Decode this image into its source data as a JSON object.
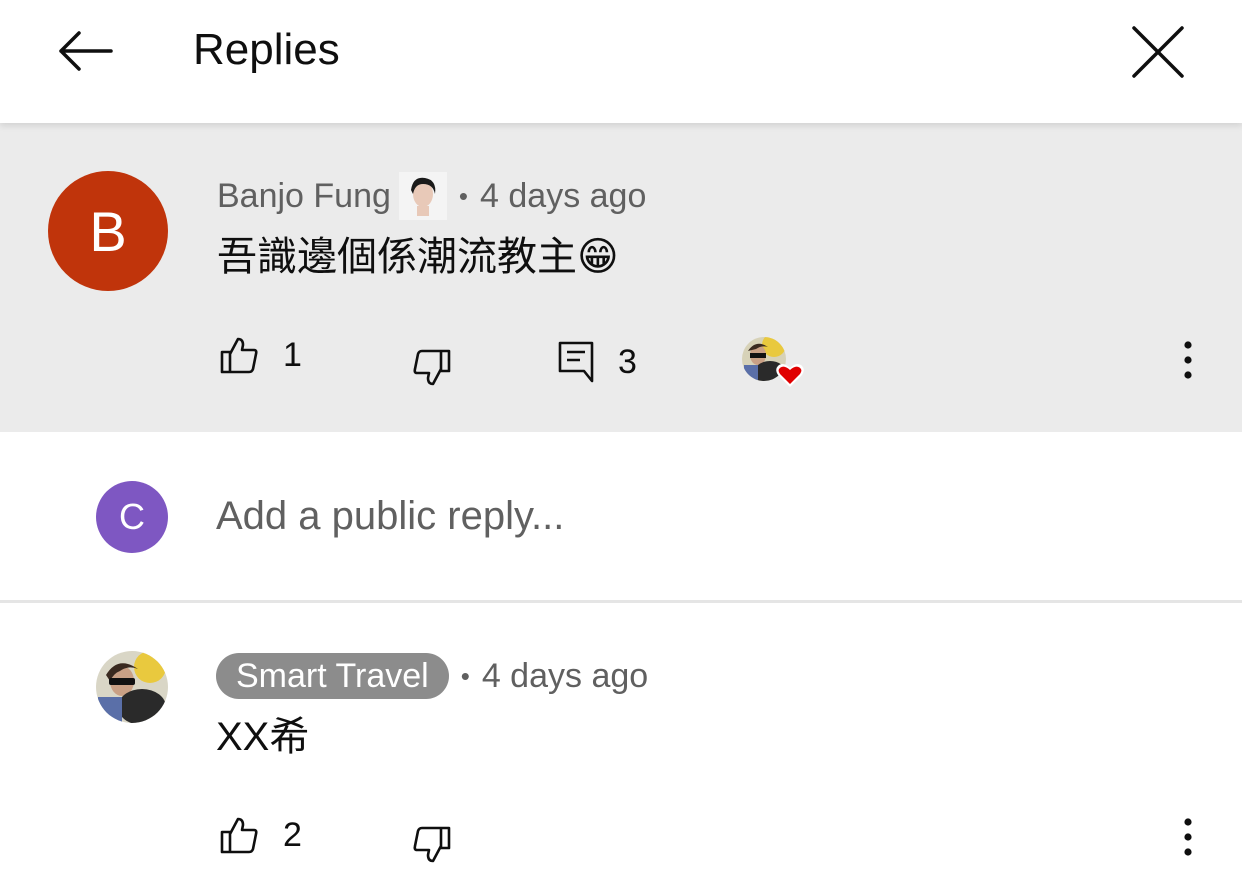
{
  "header": {
    "title": "Replies",
    "back_icon": "arrow-left-icon",
    "close_icon": "close-icon"
  },
  "parent_comment": {
    "avatar_letter": "B",
    "avatar_color": "#c0340b",
    "author": "Banjo Fung",
    "separator": "•",
    "time": "4 days ago",
    "text": "吾識邊個係潮流教主😁",
    "likes": "1",
    "replies": "3"
  },
  "reply_input": {
    "avatar_letter": "C",
    "avatar_color": "#7e57c2",
    "placeholder": "Add a public reply..."
  },
  "reply": {
    "author": "Smart Travel",
    "separator": "•",
    "time": "4 days ago",
    "text": "XX希",
    "likes": "2"
  },
  "colors": {
    "heart": "#e00000",
    "highlight_bg": "#ebebeb",
    "chip_bg": "#8c8c8c"
  }
}
